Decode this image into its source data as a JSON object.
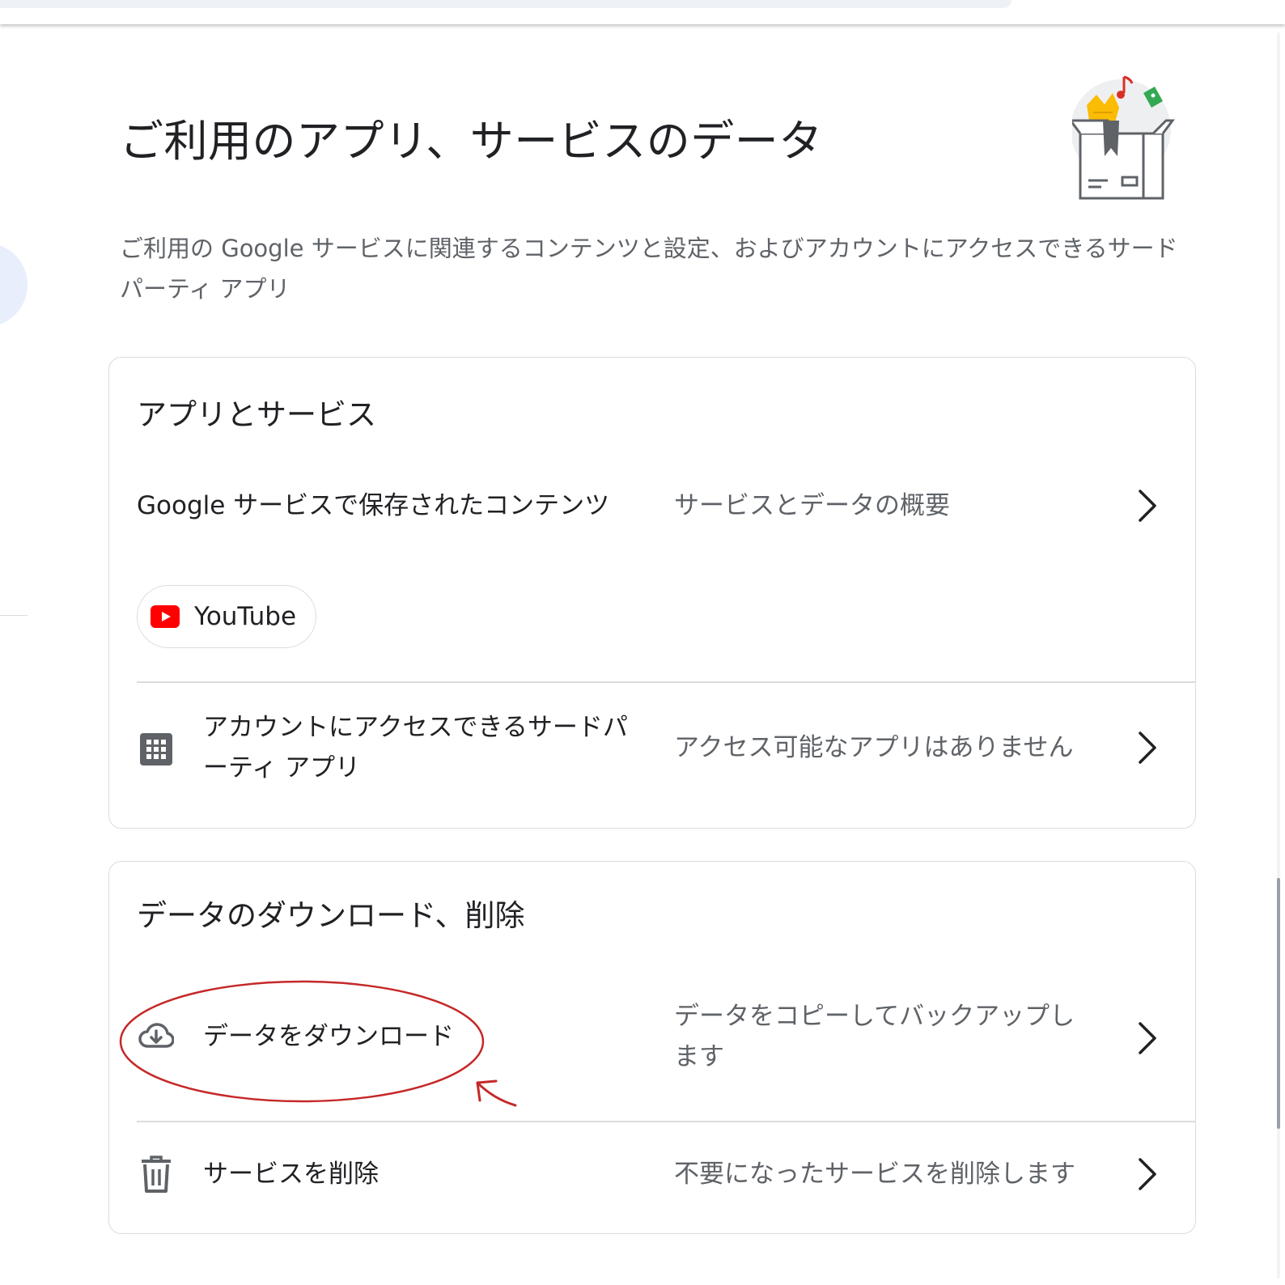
{
  "header": {
    "title": "ご利用のアプリ、サービスのデータ",
    "description": "ご利用の Google サービスに関連するコンテンツと設定、およびアカウントにアクセスできるサードパーティ アプリ",
    "illustration_icon": "gift-box-icon"
  },
  "apps_card": {
    "title": "アプリとサービス",
    "rows": [
      {
        "label": "Google サービスで保存されたコンテンツ",
        "value": "サービスとデータの概要"
      },
      {
        "label": "アカウントにアクセスできるサードパーティ アプリ",
        "value": "アクセス可能なアプリはありません",
        "icon": "apps-grid-icon"
      }
    ],
    "chips": [
      {
        "label": "YouTube",
        "icon": "youtube-icon"
      }
    ]
  },
  "data_card": {
    "title": "データのダウンロード、削除",
    "rows": [
      {
        "label": "データをダウンロード",
        "value": "データをコピーしてバックアップします",
        "icon": "cloud-download-icon"
      },
      {
        "label": "サービスを削除",
        "value": "不要になったサービスを削除します",
        "icon": "trash-icon"
      }
    ]
  },
  "colors": {
    "accent_annotation": "#c62828",
    "youtube_red": "#ff0000",
    "icon_gray": "#5f6368",
    "border": "#dadce0"
  }
}
